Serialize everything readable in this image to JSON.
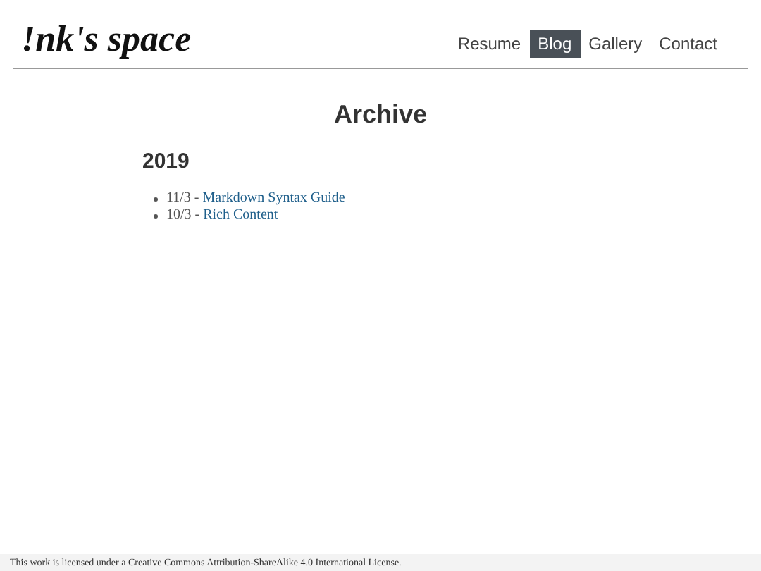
{
  "site_title": "!nk's space",
  "nav": [
    {
      "label": "Resume",
      "selected": false
    },
    {
      "label": "Blog",
      "selected": true
    },
    {
      "label": "Gallery",
      "selected": false
    },
    {
      "label": "Contact",
      "selected": false
    }
  ],
  "heading": "Archive",
  "years": [
    {
      "year": "2019",
      "posts": [
        {
          "date": "11/3",
          "separator": "-",
          "title": "Markdown Syntax Guide"
        },
        {
          "date": "10/3",
          "separator": "-",
          "title": "Rich Content"
        }
      ]
    }
  ],
  "footer": "This work is licensed under a Creative Commons Attribution-ShareAlike 4.0 International License."
}
